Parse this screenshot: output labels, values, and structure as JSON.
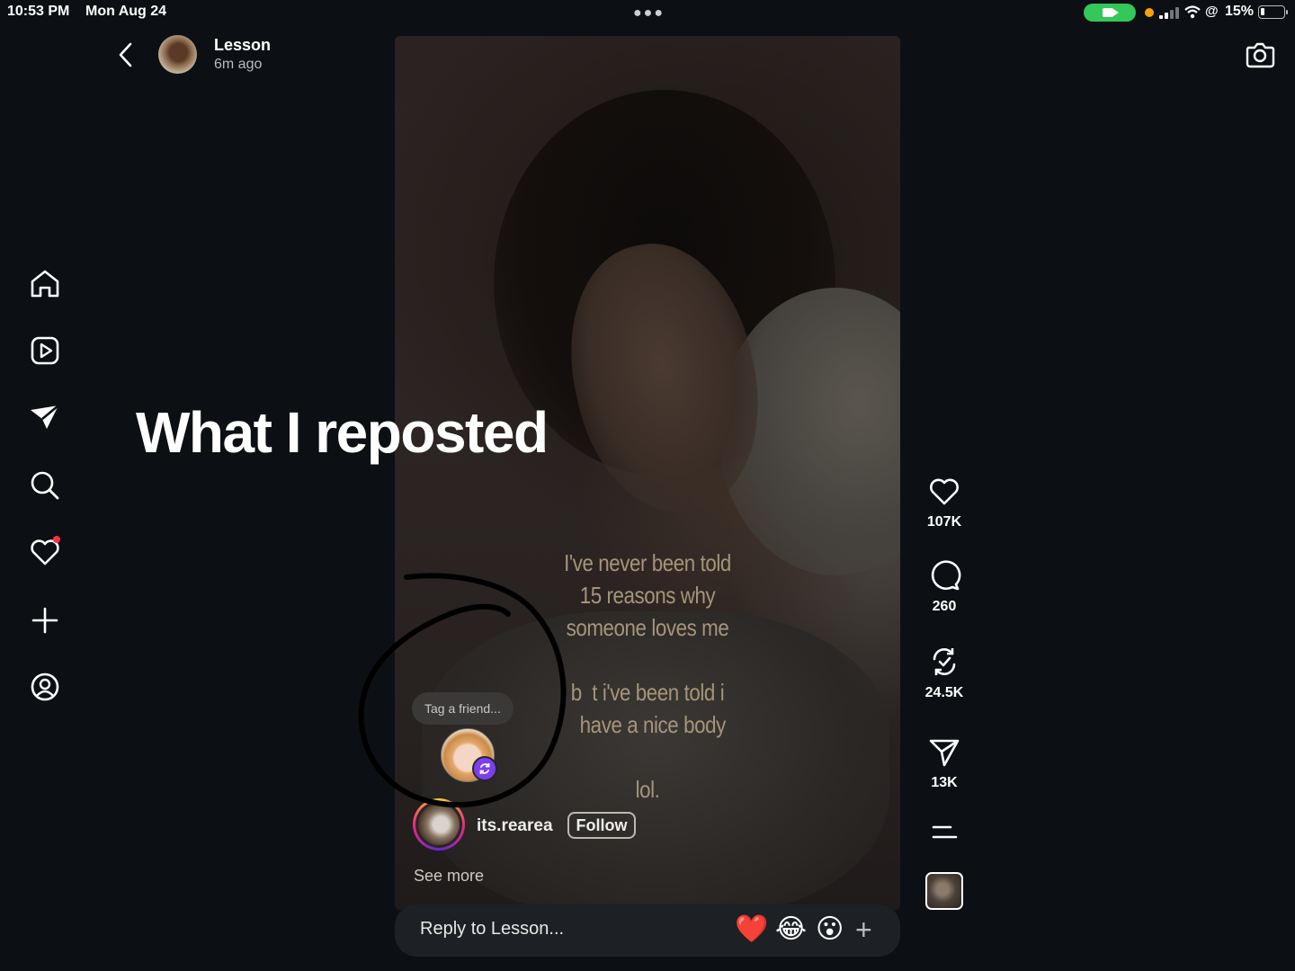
{
  "status_bar": {
    "time": "10:53 PM",
    "date": "Mon Aug 24",
    "battery": "15%",
    "at_symbol": "@"
  },
  "story_header": {
    "username": "Lesson",
    "time_ago": "6m ago"
  },
  "annotation": {
    "caption": "What I reposted"
  },
  "post": {
    "overlay_text_1": "I've never been told\n15 reasons why\nsomeone loves me",
    "overlay_text_2": "b  t i've been told i\n  have a nice body",
    "overlay_text_3": "lol.",
    "tag_placeholder": "Tag a friend...",
    "author": "its.rearea",
    "follow_label": "Follow",
    "see_more_label": "See more"
  },
  "actions": {
    "likes": "107K",
    "comments": "260",
    "reposts": "24.5K",
    "shares": "13K"
  },
  "reply": {
    "placeholder": "Reply to Lesson...",
    "emoji_heart": "❤️",
    "emoji_laugh": "😂",
    "emoji_wow": "😮",
    "add_label": "+"
  },
  "sidebar_icons": [
    "home-icon",
    "reels-icon",
    "direct-icon",
    "search-icon",
    "notifications-icon",
    "create-icon",
    "profile-icon"
  ],
  "colors": {
    "background": "#0c1014",
    "notification_dot": "#ff3040",
    "camera_pill": "#34c759",
    "repost_badge": "#7b3ff2"
  }
}
